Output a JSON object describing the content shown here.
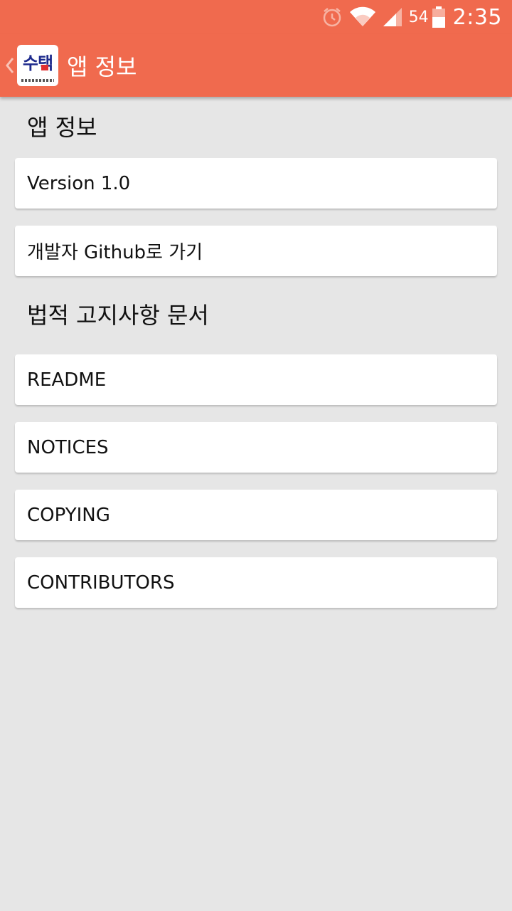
{
  "status_bar": {
    "battery_level": "54",
    "time": "2:35",
    "icons": [
      "alarm-icon",
      "wifi-icon",
      "signal-icon",
      "battery-icon"
    ]
  },
  "action_bar": {
    "title": "앱 정보",
    "app_icon_text": "수택",
    "back_icon": "chevron-left-icon"
  },
  "sections": {
    "app_info": {
      "header": "앱 정보",
      "items": [
        "Version 1.0",
        "개발자 Github로 가기"
      ]
    },
    "legal": {
      "header": "법적 고지사항 문서",
      "items": [
        "README",
        "NOTICES",
        "COPYING",
        "CONTRIBUTORS"
      ]
    }
  },
  "colors": {
    "accent": "#f06a4e",
    "background": "#e6e6e6",
    "card": "#ffffff"
  }
}
